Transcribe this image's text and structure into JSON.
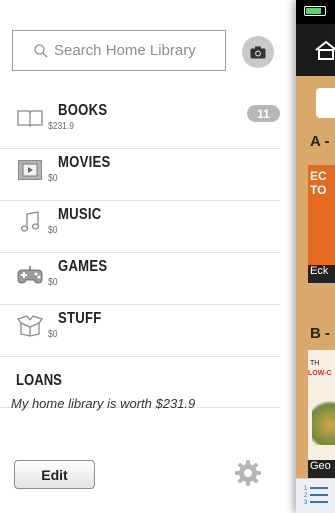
{
  "search": {
    "placeholder": "Search Home Library"
  },
  "categories": [
    {
      "name": "BOOKS",
      "value": "$231.9",
      "badge": "11",
      "icon": "book-icon"
    },
    {
      "name": "MOVIES",
      "value": "$0",
      "icon": "movie-icon"
    },
    {
      "name": "MUSIC",
      "value": "$0",
      "icon": "music-note-icon"
    },
    {
      "name": "GAMES",
      "value": "$0",
      "icon": "gamepad-icon"
    },
    {
      "name": "STUFF",
      "value": "$0",
      "icon": "box-icon"
    }
  ],
  "loans": {
    "label": "LOANS"
  },
  "summary": {
    "worth_text": "My home library is worth $231.9"
  },
  "footer": {
    "edit_label": "Edit",
    "settings_icon": "gear-icon"
  },
  "panel": {
    "sections": [
      "A -",
      "B -"
    ],
    "book1": {
      "cover_text": "EC\nTO",
      "caption": "Eck"
    },
    "book2": {
      "title_text": "TH",
      "subtitle_text": "LOW-C",
      "caption": "Geo"
    },
    "colors": {
      "shelf": "#d9a86a",
      "book1_cover": "#e36a1f"
    }
  }
}
